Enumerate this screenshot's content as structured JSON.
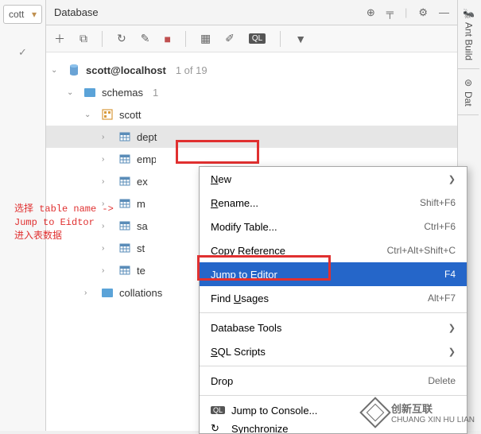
{
  "leftPanel": {
    "dropdown": "cott"
  },
  "header": {
    "title": "Database"
  },
  "tree": {
    "root": {
      "label": "scott@localhost",
      "meta": "1 of 19"
    },
    "schemas": {
      "label": "schemas",
      "meta": "1"
    },
    "schema_scott": "scott",
    "tables": {
      "dept": "dept",
      "emp": "emp",
      "ex": "ex",
      "m": "m",
      "sa": "sa",
      "st": "st",
      "te": "te"
    },
    "collations": "collations"
  },
  "annotation": "选择 table name ->\nJump to Eidtor\n进入表数据",
  "contextMenu": {
    "new": "New",
    "rename": "Rename...",
    "rename_sc": "Shift+F6",
    "modify": "Modify Table...",
    "modify_sc": "Ctrl+F6",
    "copyref": "Copy Reference",
    "copyref_sc": "Ctrl+Alt+Shift+C",
    "jump": "Jump to Editor",
    "jump_sc": "F4",
    "find": "Find Usages",
    "find_sc": "Alt+F7",
    "dbtools": "Database Tools",
    "sqlscripts": "SQL Scripts",
    "drop": "Drop",
    "drop_sc": "Delete",
    "jumpconsole": "Jump to Console...",
    "sync": "Synchronize"
  },
  "rightTabs": {
    "ant": "Ant Build",
    "dat": "Dat"
  },
  "watermark": {
    "cn": "创新互联",
    "en": "CHUANG XIN HU LIAN"
  }
}
